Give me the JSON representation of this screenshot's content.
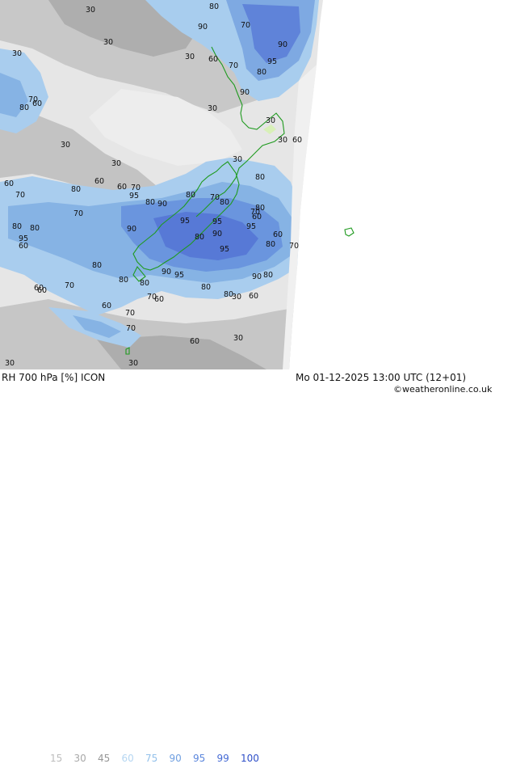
{
  "map": {
    "contour_labels": [
      "30",
      "80",
      "70",
      "90",
      "30",
      "90",
      "95",
      "30",
      "60",
      "70",
      "80",
      "30",
      "90",
      "70",
      "60",
      "80",
      "30",
      "30",
      "30",
      "60",
      "30",
      "30",
      "80",
      "30",
      "60",
      "80",
      "70",
      "60",
      "70",
      "60",
      "95",
      "80",
      "90",
      "80",
      "70",
      "80",
      "60",
      "90",
      "80",
      "70",
      "95",
      "80",
      "95",
      "80",
      "90",
      "60",
      "95",
      "80",
      "95",
      "70",
      "60",
      "80",
      "70",
      "95",
      "90",
      "60",
      "80",
      "80",
      "80",
      "60",
      "70",
      "80",
      "70",
      "70",
      "60",
      "60",
      "90",
      "95",
      "80",
      "30",
      "80",
      "60",
      "70",
      "30",
      "60",
      "30",
      "30"
    ],
    "colors": {
      "sea_grey_light": "#e8e8e8",
      "grey_mid": "#c6c6c6",
      "grey_dark": "#a9a9a9",
      "rh_60": "#c9e2f6",
      "rh_70": "#a6cdee",
      "rh_80": "#86b4e3",
      "rh_90": "#6c97dd",
      "rh_95": "#5b7ed9",
      "coastline": "#22aa22",
      "outside_domain": "#ffffff"
    }
  },
  "footer": {
    "title": "RH 700 hPa [%] ICON",
    "datetime": "Mo 01-12-2025 13:00 UTC (12+01)",
    "credit": "©weatheronline.co.uk",
    "legend": [
      {
        "label": "15",
        "color": "#bdbdbd"
      },
      {
        "label": "30",
        "color": "#a8a8a8"
      },
      {
        "label": "45",
        "color": "#969696"
      },
      {
        "label": "60",
        "color": "#b5d6f2"
      },
      {
        "label": "75",
        "color": "#92c0ea"
      },
      {
        "label": "90",
        "color": "#6f9fe0"
      },
      {
        "label": "95",
        "color": "#5b86dc"
      },
      {
        "label": "99",
        "color": "#4469d4"
      },
      {
        "label": "100",
        "color": "#2e4fc8"
      }
    ]
  }
}
